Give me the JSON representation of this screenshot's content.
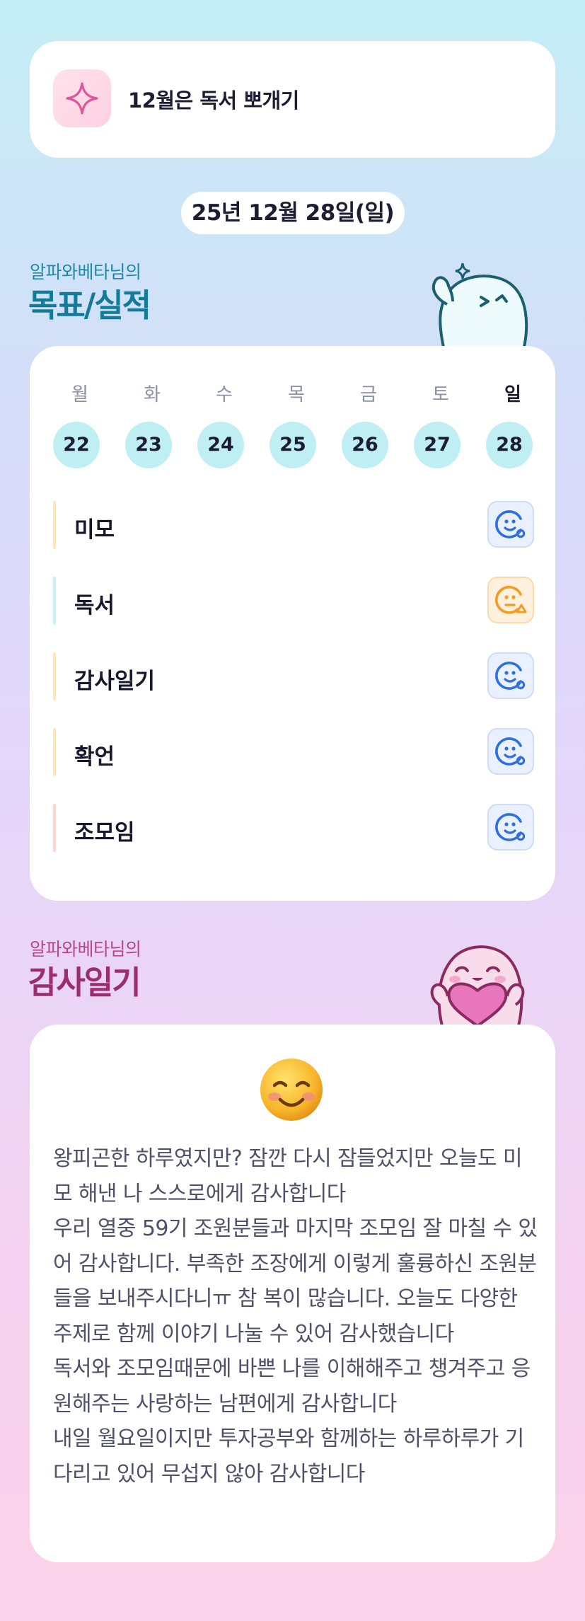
{
  "banner": {
    "text": "12월은 독서 뽀개기",
    "icon": "sparkle-icon"
  },
  "date_label": "25년 12월 28일(일)",
  "goals_section": {
    "subtitle": "알파와베타님의",
    "title": "목표/실적",
    "days": [
      {
        "name": "월",
        "num": "22"
      },
      {
        "name": "화",
        "num": "23"
      },
      {
        "name": "수",
        "num": "24"
      },
      {
        "name": "목",
        "num": "25"
      },
      {
        "name": "금",
        "num": "26"
      },
      {
        "name": "토",
        "num": "27"
      },
      {
        "name": "일",
        "num": "28"
      }
    ],
    "goals": [
      {
        "label": "미모",
        "bar_color": "#fde7b7",
        "status": "done-smile-icon"
      },
      {
        "label": "독서",
        "bar_color": "#c8f0ec",
        "status": "partial-warning-icon"
      },
      {
        "label": "감사일기",
        "bar_color": "#fde7b7",
        "status": "done-smile-icon"
      },
      {
        "label": "확언",
        "bar_color": "#fde7b7",
        "status": "done-smile-icon"
      },
      {
        "label": "조모임",
        "bar_color": "#fbd3d3",
        "status": "done-smile-icon"
      }
    ]
  },
  "gratitude_section": {
    "subtitle": "알파와베타님의",
    "title": "감사일기",
    "emoji": "smiling-face-icon",
    "text": "왕피곤한 하루였지만? 잠깐 다시 잠들었지만 오늘도 미모 해낸 나 스스로에게 감사합니다\n우리 열중 59기 조원분들과 마지막 조모임 잘 마칠 수 있어 감사합니다. 부족한 조장에게 이렇게 훌륭하신 조원분들을 보내주시다니ㅠ 참 복이 많습니다. 오늘도 다양한 주제로 함께 이야기 나눌 수 있어 감사했습니다\n독서와 조모임때문에 바쁜 나를 이해해주고 챙겨주고 응원해주는 사랑하는 남편에게 감사합니다\n내일 월요일이지만 투자공부와 함께하는 하루하루가 기다리고 있어 무섭지 않아 감사합니다"
  },
  "colors": {
    "teal_title": "#137a98",
    "magenta_title": "#9b2d6b",
    "day_circle": "#bfeff3",
    "status_blue": "#2f6fe0",
    "status_orange": "#f59a23"
  }
}
